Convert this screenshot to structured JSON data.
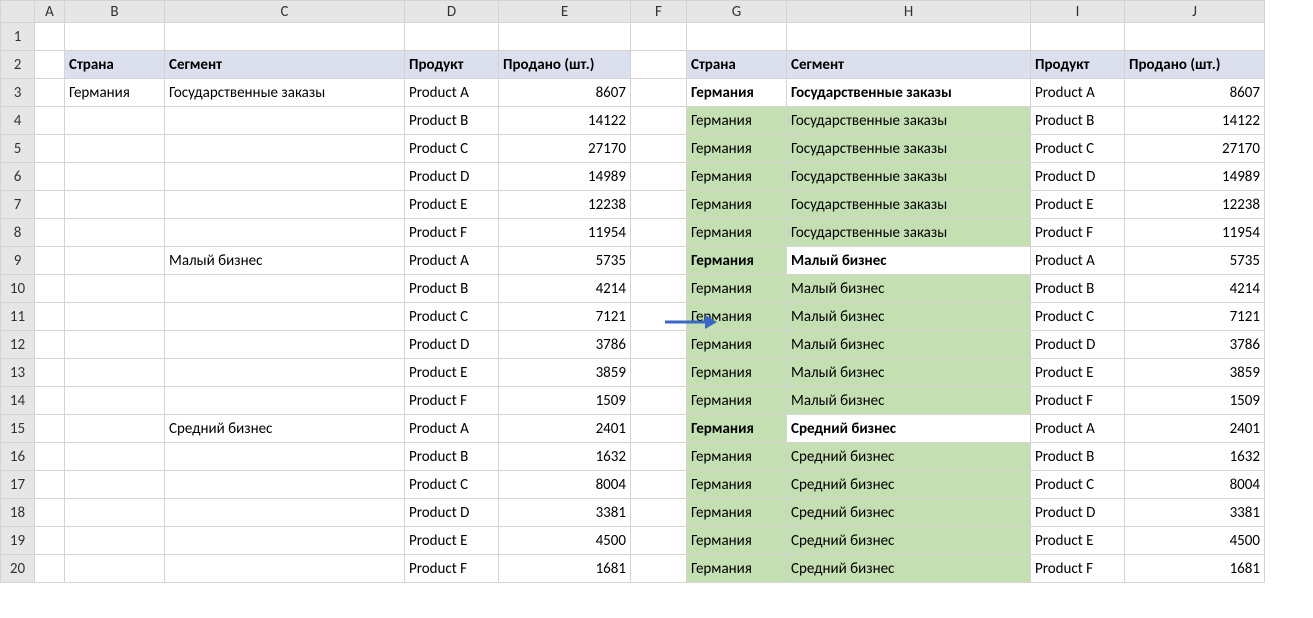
{
  "columns": [
    "A",
    "B",
    "C",
    "D",
    "E",
    "F",
    "G",
    "H",
    "I",
    "J"
  ],
  "rowCount": 20,
  "headers": {
    "country": "Страна",
    "segment": "Сегмент",
    "product": "Продукт",
    "sold": "Продано (шт.)"
  },
  "leftTable": {
    "rows": [
      {
        "country": "Германия",
        "segment": "Государственные заказы",
        "product": "Product A",
        "sold": 8607
      },
      {
        "country": "",
        "segment": "",
        "product": "Product B",
        "sold": 14122
      },
      {
        "country": "",
        "segment": "",
        "product": "Product C",
        "sold": 27170
      },
      {
        "country": "",
        "segment": "",
        "product": "Product D",
        "sold": 14989
      },
      {
        "country": "",
        "segment": "",
        "product": "Product E",
        "sold": 12238
      },
      {
        "country": "",
        "segment": "",
        "product": "Product F",
        "sold": 11954
      },
      {
        "country": "",
        "segment": "Малый бизнес",
        "product": "Product A",
        "sold": 5735
      },
      {
        "country": "",
        "segment": "",
        "product": "Product B",
        "sold": 4214
      },
      {
        "country": "",
        "segment": "",
        "product": "Product C",
        "sold": 7121
      },
      {
        "country": "",
        "segment": "",
        "product": "Product D",
        "sold": 3786
      },
      {
        "country": "",
        "segment": "",
        "product": "Product E",
        "sold": 3859
      },
      {
        "country": "",
        "segment": "",
        "product": "Product F",
        "sold": 1509
      },
      {
        "country": "",
        "segment": "Средний бизнес",
        "product": "Product A",
        "sold": 2401
      },
      {
        "country": "",
        "segment": "",
        "product": "Product B",
        "sold": 1632
      },
      {
        "country": "",
        "segment": "",
        "product": "Product C",
        "sold": 8004
      },
      {
        "country": "",
        "segment": "",
        "product": "Product D",
        "sold": 3381
      },
      {
        "country": "",
        "segment": "",
        "product": "Product E",
        "sold": 4500
      },
      {
        "country": "",
        "segment": "",
        "product": "Product F",
        "sold": 1681
      }
    ]
  },
  "rightTable": {
    "rows": [
      {
        "country": "Германия",
        "segment": "Государственные заказы",
        "product": "Product A",
        "sold": 8607,
        "bold": true,
        "green": false
      },
      {
        "country": "Германия",
        "segment": "Государственные заказы",
        "product": "Product B",
        "sold": 14122,
        "bold": false,
        "green": true
      },
      {
        "country": "Германия",
        "segment": "Государственные заказы",
        "product": "Product C",
        "sold": 27170,
        "bold": false,
        "green": true
      },
      {
        "country": "Германия",
        "segment": "Государственные заказы",
        "product": "Product D",
        "sold": 14989,
        "bold": false,
        "green": true
      },
      {
        "country": "Германия",
        "segment": "Государственные заказы",
        "product": "Product E",
        "sold": 12238,
        "bold": false,
        "green": true
      },
      {
        "country": "Германия",
        "segment": "Государственные заказы",
        "product": "Product F",
        "sold": 11954,
        "bold": false,
        "green": true
      },
      {
        "country": "Германия",
        "segment": "Малый бизнес",
        "product": "Product A",
        "sold": 5735,
        "bold": true,
        "green": false,
        "countryGreen": true
      },
      {
        "country": "Германия",
        "segment": "Малый бизнес",
        "product": "Product B",
        "sold": 4214,
        "bold": false,
        "green": true
      },
      {
        "country": "Германия",
        "segment": "Малый бизнес",
        "product": "Product C",
        "sold": 7121,
        "bold": false,
        "green": true
      },
      {
        "country": "Германия",
        "segment": "Малый бизнес",
        "product": "Product D",
        "sold": 3786,
        "bold": false,
        "green": true
      },
      {
        "country": "Германия",
        "segment": "Малый бизнес",
        "product": "Product E",
        "sold": 3859,
        "bold": false,
        "green": true
      },
      {
        "country": "Германия",
        "segment": "Малый бизнес",
        "product": "Product F",
        "sold": 1509,
        "bold": false,
        "green": true
      },
      {
        "country": "Германия",
        "segment": "Средний бизнес",
        "product": "Product A",
        "sold": 2401,
        "bold": true,
        "green": false,
        "countryGreen": true
      },
      {
        "country": "Германия",
        "segment": "Средний бизнес",
        "product": "Product B",
        "sold": 1632,
        "bold": false,
        "green": true
      },
      {
        "country": "Германия",
        "segment": "Средний бизнес",
        "product": "Product C",
        "sold": 8004,
        "bold": false,
        "green": true
      },
      {
        "country": "Германия",
        "segment": "Средний бизнес",
        "product": "Product D",
        "sold": 3381,
        "bold": false,
        "green": true
      },
      {
        "country": "Германия",
        "segment": "Средний бизнес",
        "product": "Product E",
        "sold": 4500,
        "bold": false,
        "green": true
      },
      {
        "country": "Германия",
        "segment": "Средний бизнес",
        "product": "Product F",
        "sold": 1681,
        "bold": false,
        "green": true
      }
    ]
  }
}
